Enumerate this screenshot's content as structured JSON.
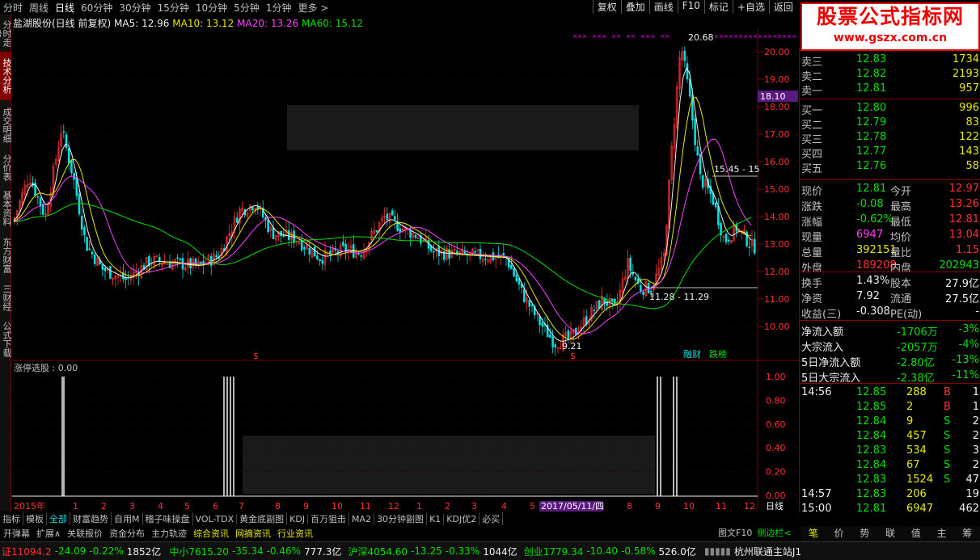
{
  "topbar": {
    "items": [
      "分时",
      "周线",
      "日线",
      "60分钟",
      "30分钟",
      "15分钟",
      "10分钟",
      "5分钟",
      "1分钟",
      "更多 >"
    ],
    "tools": [
      "复权",
      "叠加",
      "画线",
      "F10",
      "标记",
      "+自选",
      "返回"
    ]
  },
  "logo": {
    "title": "股票公式指标网",
    "url": "www.gszx.com.cn"
  },
  "vtabs": [
    "分时走势",
    "技术分析",
    "成交明细",
    "分价表",
    "基本资料",
    "东方财富",
    "三财经",
    "公式下载"
  ],
  "chart": {
    "title": "盐湖股份(日线 前复权)",
    "ma5": "MA5: 12.96",
    "ma10": "MA10: 13.12",
    "ma20": "MA20: 13.26",
    "ma60": "MA60: 15.12",
    "high_label": "20.68",
    "low_label": "9.21",
    "range1": "15.45 - 15",
    "range2": "11.28 - 11.29",
    "cur_price": "18.10",
    "tags": [
      "融财",
      "跌榜"
    ],
    "yticks": [
      "20.00",
      "19.00",
      "18.00",
      "17.00",
      "16.00",
      "15.00",
      "14.00",
      "13.00",
      "12.00",
      "11.00",
      "10.00"
    ],
    "ind_title": "涨停选股 : 0.00",
    "ind_ticks": [
      "1.00",
      "0.80",
      "0.60",
      "0.40",
      "0.20",
      "0.00"
    ],
    "xlabels": [
      "2015年",
      "1",
      "2",
      "3",
      "4",
      "5",
      "6",
      "7",
      "8",
      "9",
      "10",
      "11",
      "12",
      "1",
      "2",
      "3",
      "4",
      "5",
      "2017/05/11/四",
      "8",
      "9",
      "10",
      "11",
      "12"
    ],
    "period": "日线",
    "watermark": "股票公式指标网 www.gszx.com"
  },
  "colors": {
    "ma5": "#f0f0f0",
    "ma10": "#e8e800",
    "ma20": "#ff40ff",
    "ma60": "#00e000",
    "up": "#ff3030",
    "down": "#00e0e0",
    "axis": "#800000"
  },
  "quote": {
    "sell": [
      {
        "l": "卖三",
        "p": "12.83",
        "v": "1734"
      },
      {
        "l": "卖二",
        "p": "12.82",
        "v": "2193"
      },
      {
        "l": "卖一",
        "p": "12.81",
        "v": "957"
      }
    ],
    "buy": [
      {
        "l": "买一",
        "p": "12.80",
        "v": "996"
      },
      {
        "l": "买二",
        "p": "12.79",
        "v": "83"
      },
      {
        "l": "买三",
        "p": "12.78",
        "v": "122"
      },
      {
        "l": "买四",
        "p": "12.77",
        "v": "143"
      },
      {
        "l": "买五",
        "p": "12.76",
        "v": "58"
      }
    ],
    "stats": [
      [
        "现价",
        "12.81",
        "今开",
        "12.97"
      ],
      [
        "涨跌",
        "-0.08",
        "最高",
        "13.26"
      ],
      [
        "涨幅",
        "-0.62%",
        "最低",
        "12.81"
      ],
      [
        "现量",
        "6947",
        "均价",
        "13.04"
      ],
      [
        "总量",
        "392151",
        "量比",
        "1.15"
      ],
      [
        "外盘",
        "189208",
        "内盘",
        "202943"
      ]
    ],
    "stats2": [
      [
        "换手",
        "1.43%",
        "股本",
        "27.9亿"
      ],
      [
        "净资",
        "7.92",
        "流通",
        "27.5亿"
      ],
      [
        "收益(三)",
        "-0.308",
        "PE(动)",
        "-"
      ]
    ],
    "flows": [
      [
        "净流入额",
        "-1706万",
        "-3%"
      ],
      [
        "大宗流入",
        "-2057万",
        "-4%"
      ],
      [
        "5日净流入额",
        "-2.80亿",
        "-13%"
      ],
      [
        "5日大宗流入",
        "-2.38亿",
        "-11%"
      ]
    ],
    "ticks": [
      [
        "14:56",
        "12.85",
        "288",
        "B",
        "1"
      ],
      [
        "",
        "12.85",
        "2",
        "B",
        "1"
      ],
      [
        "",
        "12.84",
        "9",
        "S",
        "2"
      ],
      [
        "",
        "12.84",
        "457",
        "S",
        "2"
      ],
      [
        "",
        "12.83",
        "534",
        "S",
        "3"
      ],
      [
        "",
        "12.84",
        "67",
        "S",
        "2"
      ],
      [
        "",
        "12.83",
        "1524",
        "S",
        "47"
      ],
      [
        "14:57",
        "12.83",
        "206",
        "",
        "19"
      ],
      [
        "15:00",
        "12.81",
        "6947",
        "",
        "462"
      ]
    ]
  },
  "bottom1": [
    "指标",
    "模板",
    "全部",
    "财富趋势",
    "自用M",
    "稽子味操盘",
    "VOL-TDX",
    "黄金底副图",
    "KDJ",
    "百万狙击",
    "MA2",
    "30分钟副图",
    "K1",
    "KDJ优2",
    "必买"
  ],
  "bottom2": [
    "开弹幕",
    "扩展∧",
    "关联报价",
    "资金分布",
    "主力轨迹",
    "综合资讯",
    "网摘资讯",
    "行业资讯"
  ],
  "bottom2r": [
    "图文F10",
    "侧边栏<"
  ],
  "panel_tabs": [
    "笔",
    "价",
    "势",
    "联",
    "值",
    "主",
    "筹"
  ],
  "status": {
    "sh": "证11094.2",
    "sh_chg": "-24.09",
    "sh_pct": "-0.22%",
    "sh_amt": "1852亿",
    "zx": "中小7615.20",
    "zx_chg": "-35.34",
    "zx_pct": "-0.46%",
    "zx_amt": "777.3亿",
    "hs": "沪深4054.60",
    "hs_chg": "-13.25",
    "hs_pct": "-0.33%",
    "hs_amt": "1044亿",
    "cy": "创业1779.34",
    "cy_chg": "-10.40",
    "cy_pct": "-0.58%",
    "cy_amt": "526.0亿",
    "server": "杭州联通主站J1"
  }
}
